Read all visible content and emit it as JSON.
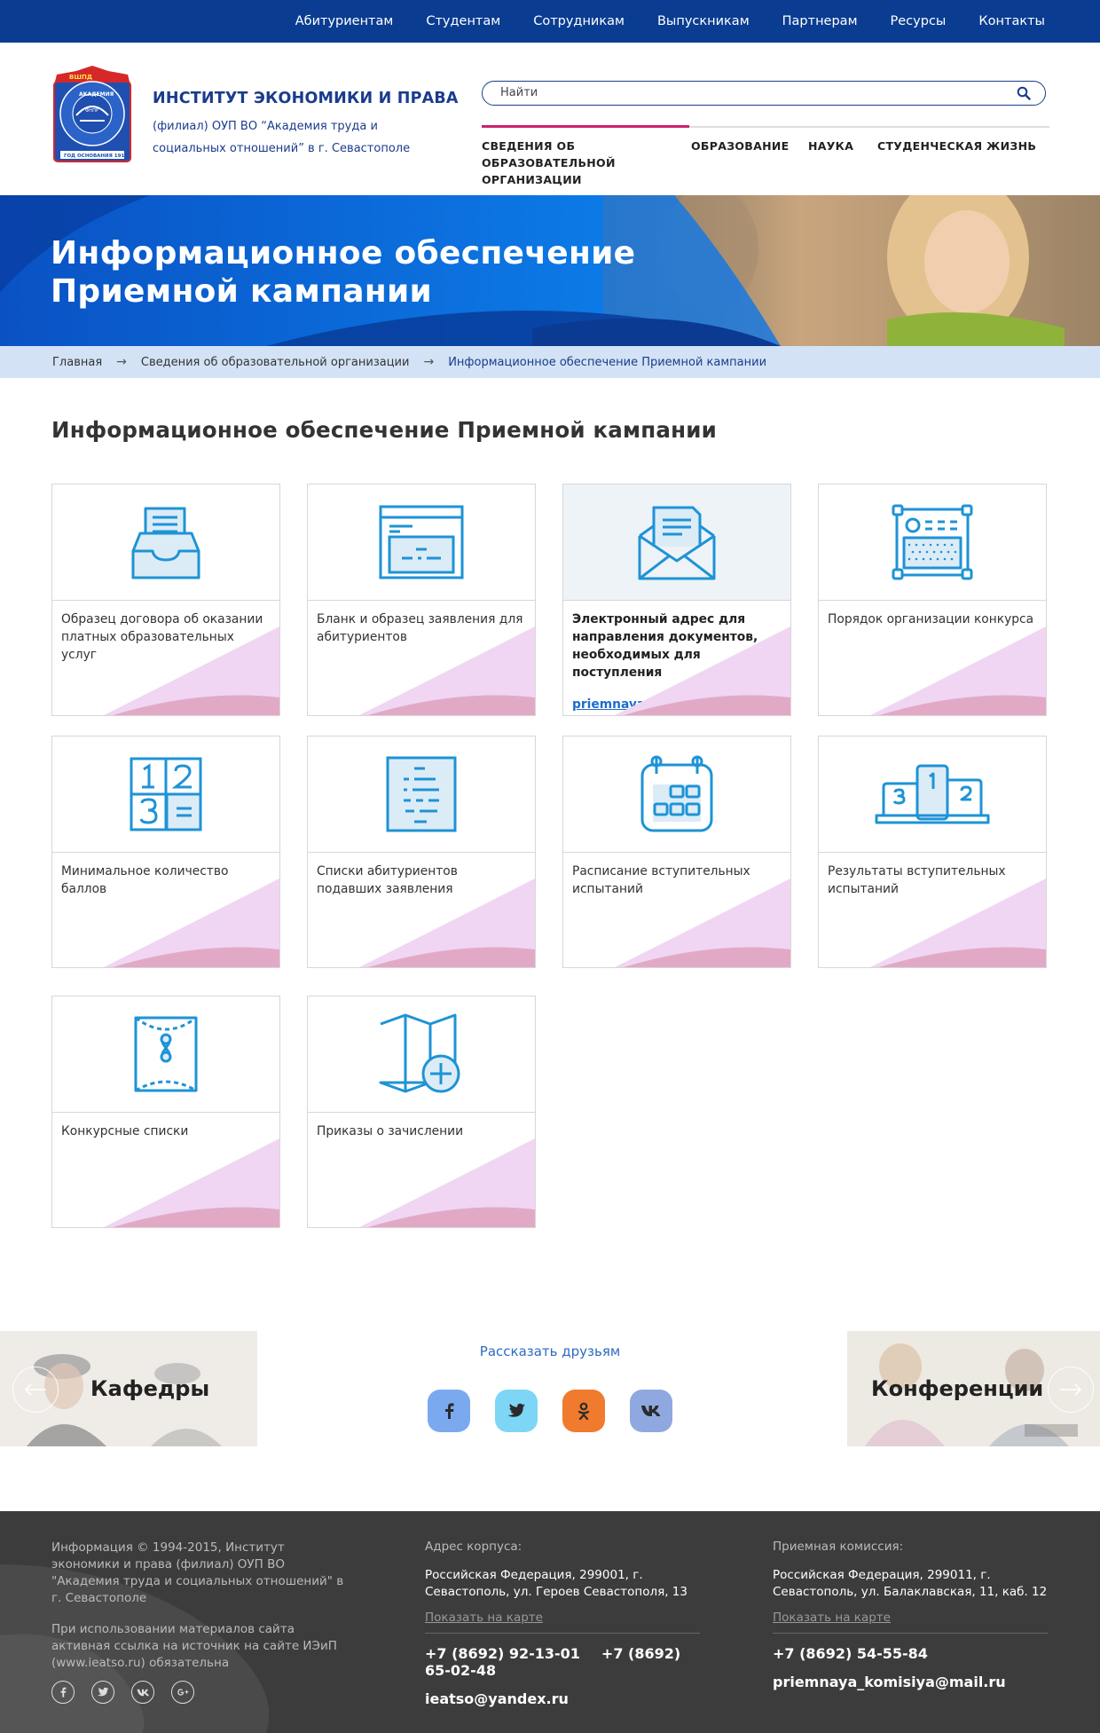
{
  "topnav": [
    "Абитуриентам",
    "Студентам",
    "Сотрудникам",
    "Выпускникам",
    "Партнерам",
    "Ресурсы",
    "Контакты"
  ],
  "brand": {
    "title": "ИНСТИТУТ ЭКОНОМИКИ И ПРАВА",
    "subtitle": "(филиал) ОУП ВО “Академия труда и социальных отношений” в г. Севастополе",
    "logo_text": [
      "ВШПД",
      "АКАДЕМИЯ",
      "ТРУДА И СОЦИАЛЬНЫХ ОТНОШЕНИЙ",
      "ФНПР",
      "ГОД ОСНОВАНИЯ 1919"
    ]
  },
  "search": {
    "placeholder": "Найти"
  },
  "mainnav": [
    "СВЕДЕНИЯ ОБ ОБРАЗОВАТЕЛЬНОЙ ОРГАНИЗАЦИИ",
    "ОБРАЗОВАНИЕ",
    "НАУКА",
    "СТУДЕНЧЕСКАЯ ЖИЗНЬ"
  ],
  "banner": {
    "title": "Информационное обеспечение Приемной кампании"
  },
  "breadcrumbs": [
    "Главная",
    "Сведения об образовательной организации",
    "Информационное обеспечение Приемной кампании"
  ],
  "page_title": "Информационное обеспечение Приемной кампании",
  "cards": [
    {
      "text": "Образец договора об оказании платных образовательных услуг",
      "icon": "inbox-tray-icon"
    },
    {
      "text": "Бланк и образец заявления для абитуриентов",
      "icon": "form-window-icon"
    },
    {
      "text": "Электронный адрес для направления документов, необходимых для поступления",
      "email": "priemnaya_komisiya@mail.ru",
      "icon": "envelope-icon"
    },
    {
      "text": "Порядок организации конкурса",
      "icon": "calculator-box-icon"
    },
    {
      "text": "Минимальное количество баллов",
      "icon": "number-grid-icon"
    },
    {
      "text": "Списки абитуриентов подавших заявления",
      "icon": "list-document-icon"
    },
    {
      "text": "Расписание вступительных испытаний",
      "icon": "calendar-icon"
    },
    {
      "text": "Результаты вступительных испытаний",
      "icon": "podium-icon"
    },
    {
      "text": "Конкурсные списки",
      "icon": "sealed-envelope-icon"
    },
    {
      "text": "Приказы о зачислении",
      "icon": "map-plus-icon"
    }
  ],
  "share": {
    "title": "Рассказать друзьям",
    "left_promo": "Кафедры",
    "right_promo": "Конференции",
    "networks": [
      "facebook",
      "twitter",
      "odnoklassniki",
      "vkontakte"
    ]
  },
  "footer": {
    "copyright": "Информация © 1994-2015, Институт экономики и права (филиал) ОУП ВО \"Академия труда и социальных отношений\" в г. Севастополе",
    "notice": "При использовании материалов сайта активная ссылка на источник на сайте ИЭиП (www.ieatso.ru) обязательна",
    "campus": {
      "heading": "Адрес корпуса:",
      "address": "Российская Федерация, 299001, г. Севастополь, ул. Героев Севастополя, 13",
      "map_link": "Показать на карте",
      "phone1": "+7 (8692) 92-13-01",
      "phone2": "+7 (8692) 65-02-48",
      "email": "ieatso@yandex.ru"
    },
    "admission": {
      "heading": "Приемная комиссия:",
      "address": "Российская Федерация, 299011, г. Севастополь, ул. Балаклавская, 11, каб. 12",
      "map_link": "Показать на карте",
      "phone": "+7 (8692) 54-55-84",
      "email": "priemnaya_komisiya@mail.ru"
    }
  },
  "colors": {
    "topbar": "#0a3d91",
    "brand_blue": "#1a3c8c",
    "active_tab": "#c8236e",
    "icon_blue": "#1e93d6",
    "breadcrumb_bg": "#d3e3f5",
    "footer_bg": "#3c3c3c"
  }
}
